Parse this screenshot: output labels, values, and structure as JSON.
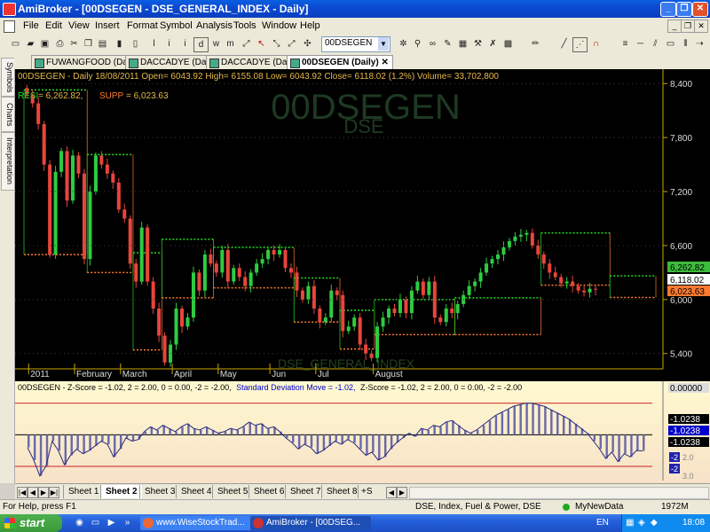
{
  "window": {
    "title": "AmiBroker - [00DSEGEN - DSE_GENERAL_INDEX - Daily]",
    "controls": [
      "_",
      "❐",
      "✕"
    ]
  },
  "menu": [
    "File",
    "Edit",
    "View",
    "Insert",
    "Format",
    "Symbol",
    "Analysis",
    "Tools",
    "Window",
    "Help"
  ],
  "toolbar": {
    "symbol_value": "00DSEGEN",
    "tool_glyphs": [
      "l",
      "i",
      "d",
      "T"
    ]
  },
  "left_tabs": [
    "Symbols",
    "Charts",
    "Interpretation"
  ],
  "doc_tabs": [
    {
      "label": "FUWANGFOOD (Daily)",
      "active": false
    },
    {
      "label": "DACCADYE (Daily)",
      "active": false
    },
    {
      "label": "DACCADYE (Daily)",
      "active": false
    },
    {
      "label": "00DSEGEN (Daily)",
      "active": true
    }
  ],
  "chart": {
    "header_line": "00DSEGEN - Daily 18/08/2011   Open= 6043.92   High= 6155.08   Low= 6043.92   Close= 6118.02 (1.2%)   Volume= 33,702,800",
    "legend": {
      "resi_label": "RESI",
      "resi_value": "= 6,262.82,",
      "supp_label": "SUPP",
      "supp_value": "= 6,023.63"
    },
    "watermark_symbol": "00DSEGEN",
    "watermark_market": "DSE",
    "watermark_name": "DSE_GENERAL_INDEX",
    "y_ticks": [
      "8,400",
      "7,800",
      "7,200",
      "6,600",
      "6,000",
      "5,400"
    ],
    "month_labels": [
      "2011",
      "February",
      "March",
      "April",
      "May",
      "Jun",
      "Jul",
      "August"
    ],
    "value_badges": {
      "resistance": "6,262.82",
      "close": "6,118.02",
      "support": "6,023.63"
    },
    "colors": {
      "up": "#2ecc40",
      "down": "#e8453c",
      "resistance": "#22dd22",
      "support": "#ff7a30",
      "axis": "#c8a800"
    }
  },
  "indicator": {
    "header_parts": [
      {
        "text": "00DSEGEN - Z-Score = -1.02, 2 = 2.00, 0 = 0.00, -2 = -2.00,",
        "color": "#000"
      },
      {
        "text": "Standard Deviation Move = -1.02,",
        "color": "#0000cc"
      },
      {
        "text": "Z-Score = -1.02, 2 = 2.00, 0 = 0.00, -2 = -2.00",
        "color": "#000"
      }
    ],
    "badges": [
      {
        "text": "0.00000",
        "bg": "#dddddd",
        "fg": "#000"
      },
      {
        "text": "-1.0238",
        "bg": "#000000",
        "fg": "#fff"
      },
      {
        "text": "-1.0238",
        "bg": "#0000cc",
        "fg": "#fff"
      },
      {
        "text": "-1.0238",
        "bg": "#000000",
        "fg": "#fff"
      }
    ],
    "right_labels": [
      "2.0",
      "-2",
      "-2",
      "3.0"
    ]
  },
  "sheets": {
    "items": [
      "Sheet 1",
      "Sheet 2",
      "Sheet 3",
      "Sheet 4",
      "Sheet 5",
      "Sheet 6",
      "Sheet 7",
      "Sheet 8"
    ],
    "active": "Sheet 2",
    "extra": "+S"
  },
  "status": {
    "help": "For Help, press F1",
    "info": "DSE, Index, Fuel & Power, DSE",
    "data": "MyNewData",
    "memory": "1972M"
  },
  "taskbar": {
    "start": "start",
    "tasks": [
      {
        "label": "www.WiseStockTrad...",
        "active": false
      },
      {
        "label": "AmiBroker - [00DSEG...",
        "active": true
      }
    ],
    "lang": "EN",
    "time": "18:08"
  },
  "chart_data": {
    "type": "candlestick",
    "y_ticks": [
      8400,
      7800,
      7200,
      6600,
      6000,
      5400
    ],
    "ylim": [
      5230,
      8560
    ],
    "resistance_segments": [
      {
        "start": 0,
        "end": 11,
        "value": 8330
      },
      {
        "start": 11,
        "end": 19,
        "value": 7610
      },
      {
        "start": 19,
        "end": 24,
        "value": 6520
      },
      {
        "start": 24,
        "end": 33,
        "value": 6670
      },
      {
        "start": 33,
        "end": 47,
        "value": 6580
      },
      {
        "start": 47,
        "end": 55,
        "value": 6240
      },
      {
        "start": 55,
        "end": 61,
        "value": 5880
      },
      {
        "start": 61,
        "end": 75,
        "value": 6000
      },
      {
        "start": 75,
        "end": 90,
        "value": 6020
      },
      {
        "start": 90,
        "end": 102,
        "value": 6740
      },
      {
        "start": 102,
        "end": 110,
        "value": 6262.82
      }
    ],
    "support_segments": [
      {
        "start": 0,
        "end": 11,
        "value": 6500
      },
      {
        "start": 11,
        "end": 19,
        "value": 6300
      },
      {
        "start": 19,
        "end": 24,
        "value": 5440
      },
      {
        "start": 24,
        "end": 33,
        "value": 6020
      },
      {
        "start": 33,
        "end": 47,
        "value": 6130
      },
      {
        "start": 47,
        "end": 55,
        "value": 5750
      },
      {
        "start": 55,
        "end": 61,
        "value": 5450
      },
      {
        "start": 61,
        "end": 75,
        "value": 5610
      },
      {
        "start": 75,
        "end": 90,
        "value": 5610
      },
      {
        "start": 90,
        "end": 102,
        "value": 6160
      },
      {
        "start": 102,
        "end": 110,
        "value": 6023.63
      }
    ],
    "closes": [
      8280,
      8180,
      7950,
      7500,
      6500,
      7420,
      7650,
      7100,
      7600,
      7400,
      6450,
      7200,
      7600,
      7500,
      7400,
      7300,
      7000,
      6900,
      6400,
      6200,
      6800,
      6200,
      5900,
      5600,
      5300,
      5500,
      5900,
      5700,
      5800,
      6300,
      6100,
      6500,
      6400,
      6300,
      6550,
      6200,
      6350,
      6250,
      6150,
      6300,
      6400,
      6450,
      6550,
      6500,
      6550,
      6350,
      6300,
      6100,
      6000,
      6150,
      5900,
      5750,
      5800,
      6100,
      6050,
      5650,
      5700,
      5800,
      5500,
      5400,
      5350,
      5700,
      5800,
      5900,
      5850,
      6000,
      5850,
      6100,
      6200,
      6050,
      6200,
      5800,
      5750,
      5900,
      5850,
      5950,
      6050,
      6150,
      6200,
      6300,
      6400,
      6450,
      6500,
      6580,
      6650,
      6700,
      6720,
      6740,
      6600,
      6500,
      6400,
      6300,
      6250,
      6180,
      6200,
      6150,
      6100,
      6080,
      6120,
      6118
    ],
    "indicator_values": [
      -0.8,
      -1.6,
      -2.6,
      -2.0,
      -0.4,
      -1.0,
      -1.9,
      -1.3,
      -0.9,
      -1.2,
      -1.0,
      -0.7,
      -0.4,
      -0.6,
      -1.4,
      -0.9,
      -0.2,
      -0.4,
      -0.3,
      0.2,
      0.5,
      0.3,
      0.6,
      0.4,
      0.2,
      0.5,
      0.7,
      0.4,
      0.3,
      0.5,
      0.3,
      0.1,
      0.2,
      0.4,
      0.3,
      0.5,
      0.8,
      0.6,
      0.7,
      0.4,
      0.5,
      0.2,
      -0.2,
      -0.5,
      -0.9,
      -0.6,
      -0.8,
      -1.2,
      -1.0,
      -0.7,
      -0.4,
      -0.6,
      -0.3,
      -0.5,
      -0.9,
      -1.3,
      -1.1,
      -1.6,
      -1.4,
      -0.9,
      -0.5,
      -0.2,
      0.1,
      -0.1,
      0.4,
      0.3,
      0.6,
      0.5,
      0.8,
      0.9,
      0.6,
      0.3,
      0.1,
      0.3,
      0.6,
      0.9,
      1.2,
      1.4,
      1.6,
      1.8,
      1.9,
      2.0,
      2.0,
      1.9,
      1.8,
      1.6,
      1.4,
      1.2,
      1.0,
      0.7,
      0.4,
      0.1,
      -0.4,
      -0.9,
      -1.5,
      -1.1,
      -1.7,
      -1.2,
      -1.4,
      -1.0,
      -1.02
    ],
    "indicator_levels": [
      2.0,
      0.0,
      -2.0
    ],
    "indicator_ylim": [
      -2.9,
      2.6
    ]
  }
}
